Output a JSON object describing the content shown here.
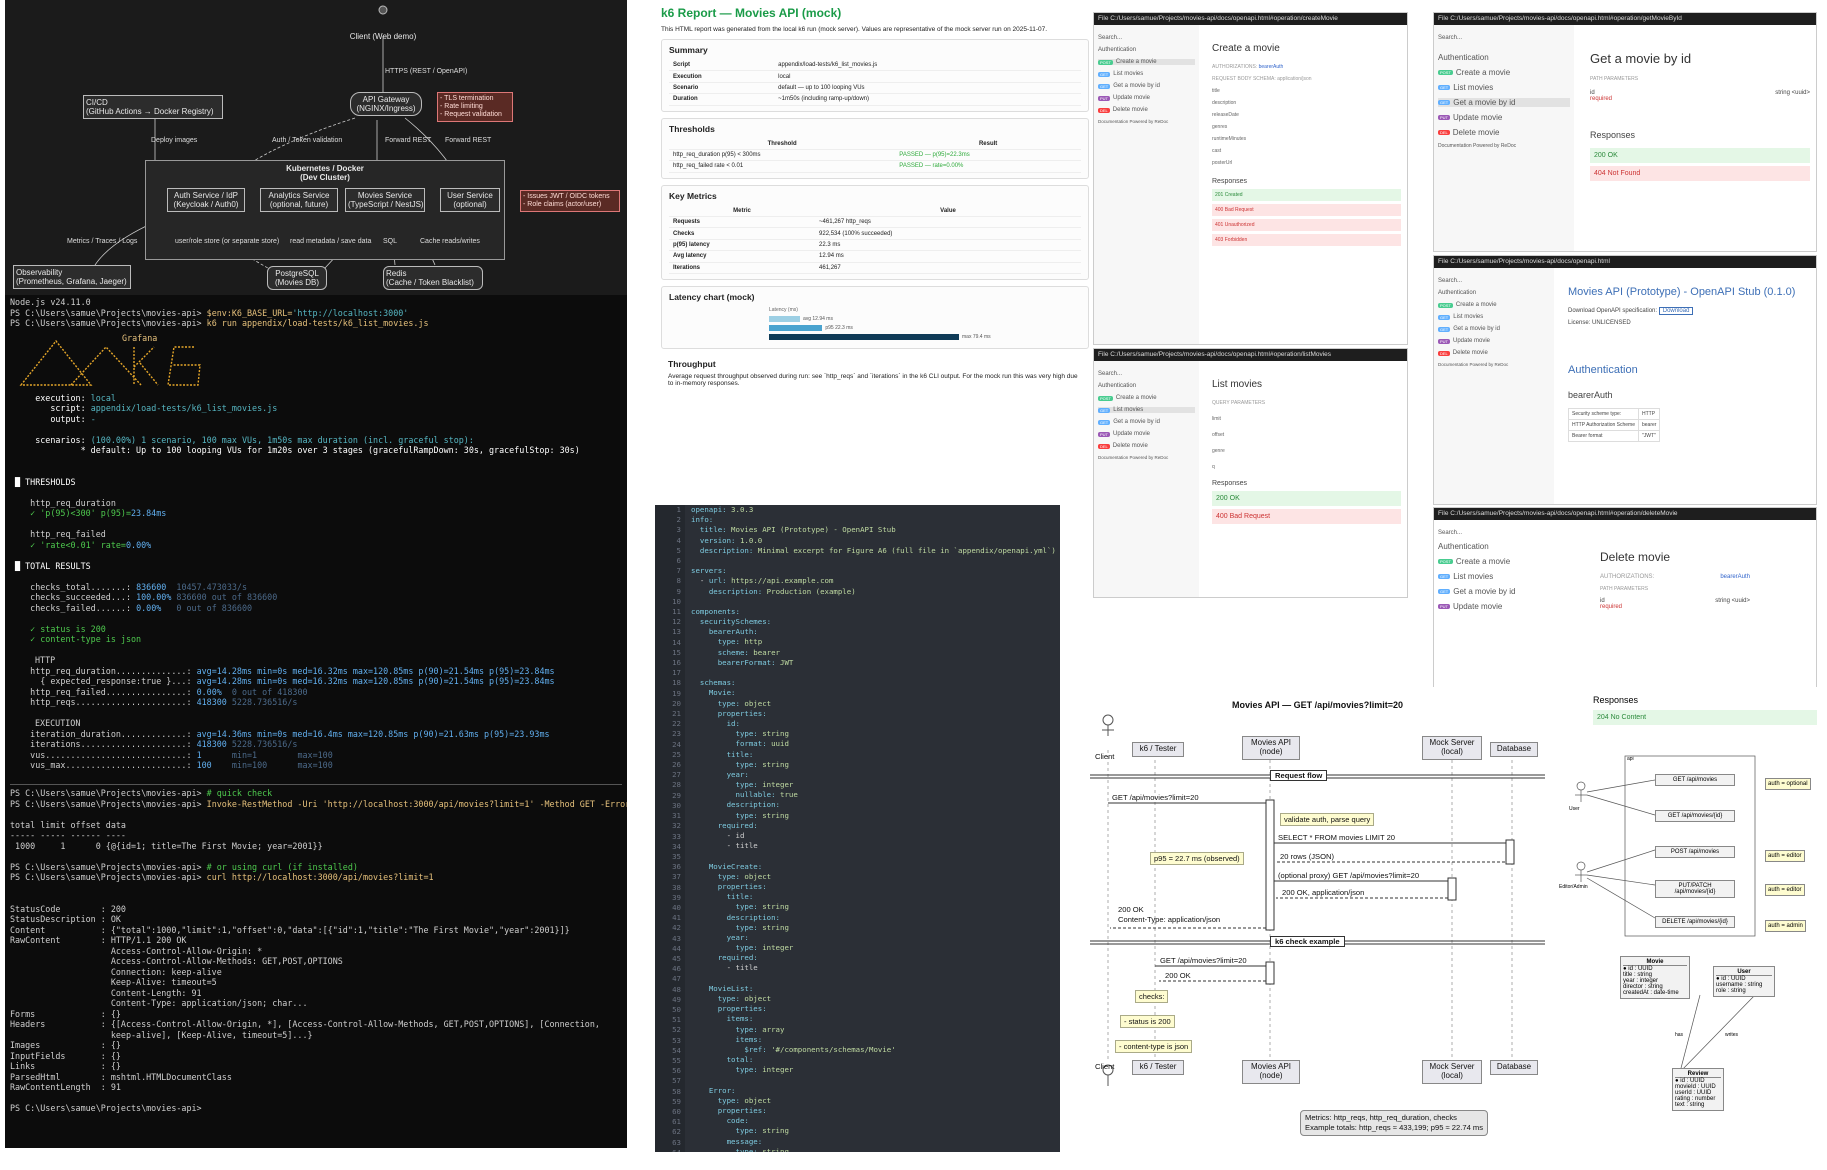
{
  "architecture": {
    "client": "Client\n(Web demo)",
    "https_label": "HTTPS (REST / OpenAPI)",
    "gateway": "API Gateway\n(NGINX/Ingress)",
    "gateway_notes": [
      "- TLS termination",
      "- Rate limiting",
      "- Request validation"
    ],
    "cicd": "CI/CD\n(GitHub Actions → Docker Registry)",
    "deploy_label": "Deploy images",
    "auth_token_label": "Auth / Token validation",
    "forward1": "Forward REST",
    "forward2": "Forward REST",
    "cluster_title": "Kubernetes / Docker\n(Dev Cluster)",
    "auth_service": "Auth Service / IdP\n(Keycloak / Auth0)",
    "analytics": "Analytics Service\n(optional, future)",
    "movies_service": "Movies Service\n(TypeScript / NestJS)",
    "user_service": "User Service\n(optional)",
    "jwt_notes": [
      "- Issues JWT / OIDC tokens",
      "- Role claims (actor/user)"
    ],
    "metrics_label": "Metrics / Traces / Logs",
    "observability": "Observability\n(Prometheus, Grafana, Jaeger)",
    "user_store_label": "user/role store (or separate store)",
    "read_label": "read metadata / save data",
    "sql_label": "SQL",
    "cache_label": "Cache reads/writes",
    "postgres": "PostgreSQL\n(Movies DB)",
    "redis": "Redis\n(Cache / Token Blacklist)"
  },
  "terminal": {
    "lines1": [
      "Node.js v24.11.0"
    ],
    "p1": "PS C:\\Users\\samue\\Projects\\movies-api> ",
    "c1": "$env:K6_BASE_URL=",
    "c1s": "'http://localhost:3000'",
    "p2": "PS C:\\Users\\samue\\Projects\\movies-api> ",
    "c2": "k6 run appendix/load-tests/k6_list_movies.js",
    "grafana": "Grafana",
    "exec_lbl": "execution:",
    "exec_val": "local",
    "script_lbl": "script:",
    "script_val": "appendix/load-tests/k6_list_movies.js",
    "output_lbl": "output:",
    "output_val": "-",
    "scen_lbl": "scenarios:",
    "scen_val": "(100.00%) 1 scenario, 100 max VUs, 1m50s max duration (incl. graceful stop):",
    "scen_def": "* default: Up to 100 looping VUs for 1m20s over 3 stages (gracefulRampDown: 30s, gracefulStop: 30s)",
    "thr_title": "THRESHOLDS",
    "thr1": "http_req_duration",
    "thr1v": "✓ 'p(95)<300' p(95)=",
    "thr1n": "23.84ms",
    "thr2": "http_req_failed",
    "thr2v": "✓ 'rate<0.01' rate=",
    "thr2n": "0.00%",
    "tot_title": "TOTAL RESULTS",
    "ct": "checks_total.......: ",
    "ctv": "836600",
    "ctd": "10457.473033/s",
    "cs": "checks_succeeded...: ",
    "csv": "100.00%",
    "csd": "836600 out of 836600",
    "cf": "checks_failed......: ",
    "cfv": "0.00%",
    "cfd": "0 out of 836600",
    "ok1": "✓ status is 200",
    "ok2": "✓ content-type is json",
    "http": "HTTP",
    "h1": "http_req_duration..............: ",
    "h1v": "avg=14.28ms min=0s med=16.32ms max=120.85ms p(90)=21.54ms p(95)=23.84ms",
    "h2": "  { expected_response:true }...: ",
    "h2v": "avg=14.28ms min=0s med=16.32ms max=120.85ms p(90)=21.54ms p(95)=23.84ms",
    "h3": "http_req_failed................: ",
    "h3v": "0.00%",
    "h3d": "0 out of 418300",
    "h4": "http_reqs......................: ",
    "h4v": "418300",
    "h4d": "5228.736516/s",
    "execu": "EXECUTION",
    "e1": "iteration_duration.............: ",
    "e1v": "avg=14.36ms min=0s med=16.4ms max=120.85ms p(90)=21.63ms p(95)=23.93ms",
    "e2": "iterations.....................: ",
    "e2v": "418300",
    "e2d": "5228.736516/s",
    "e3": "vus............................: ",
    "e3v": "1",
    "e3d": "min=1        max=100",
    "e4": "vus_max........................: ",
    "e4v": "100",
    "e4d": "min=100      max=100",
    "q1": "# quick check",
    "q1c": "Invoke-RestMethod -Uri 'http://localhost:3000/api/movies?limit=1' -Method GET -ErrorAction Stop",
    "tbl_h": "total limit offset data",
    "tbl_s": "----- ----- ------ ----",
    "tbl_r": " 1000     1      0 {@{id=1; title=The First Movie; year=2001}}",
    "q2": "# or using curl (if installed)",
    "q2c": "curl http://localhost:3000/api/movies?limit=1",
    "resp": [
      "StatusCode        : 200",
      "StatusDescription : OK",
      "Content           : {\"total\":1000,\"limit\":1,\"offset\":0,\"data\":[{\"id\":1,\"title\":\"The First Movie\",\"year\":2001}]}",
      "RawContent        : HTTP/1.1 200 OK",
      "                    Access-Control-Allow-Origin: *",
      "                    Access-Control-Allow-Methods: GET,POST,OPTIONS",
      "                    Connection: keep-alive",
      "                    Keep-Alive: timeout=5",
      "                    Content-Length: 91",
      "                    Content-Type: application/json; char...",
      "Forms             : {}",
      "Headers           : {[Access-Control-Allow-Origin, *], [Access-Control-Allow-Methods, GET,POST,OPTIONS], [Connection,",
      "                    keep-alive], [Keep-Alive, timeout=5]...}",
      "Images            : {}",
      "InputFields       : {}",
      "Links             : {}",
      "ParsedHtml        : mshtml.HTMLDocumentClass",
      "RawContentLength  : 91"
    ],
    "prompt_end": "PS C:\\Users\\samue\\Projects\\movies-api>"
  },
  "report": {
    "title": "k6 Report — Movies API (mock)",
    "intro": "This HTML report was generated from the local k6 run (mock server). Values are representative of the mock server run on 2025-11-07.",
    "summary_title": "Summary",
    "summary": [
      [
        "Script",
        "appendix/load-tests/k6_list_movies.js"
      ],
      [
        "Execution",
        "local"
      ],
      [
        "Scenario",
        "default — up to 100 looping VUs"
      ],
      [
        "Duration",
        "~1m50s (including ramp-up/down)"
      ]
    ],
    "thr_title": "Thresholds",
    "thr_cols": [
      "Threshold",
      "Result"
    ],
    "thr": [
      [
        "http_req_duration p(95) < 300ms",
        "PASSED — p(95)=22.3ms"
      ],
      [
        "http_req_failed rate < 0.01",
        "PASSED — rate=0.00%"
      ]
    ],
    "km_title": "Key Metrics",
    "km_cols": [
      "Metric",
      "Value"
    ],
    "km": [
      [
        "Requests",
        "~461,267 http_reqs"
      ],
      [
        "Checks",
        "922,534 (100% succeeded)"
      ],
      [
        "p(95) latency",
        "22.3 ms"
      ],
      [
        "Avg latency",
        "12.94 ms"
      ],
      [
        "Iterations",
        "461,267"
      ]
    ],
    "lat_title": "Latency chart (mock)",
    "lat_axis": "Latency (ms)",
    "lat": [
      {
        "label": "avg 12.94 ms",
        "value": 12.94,
        "color": "#9ccfe4"
      },
      {
        "label": "p95 22.3 ms",
        "value": 22.3,
        "color": "#4aa3cf"
      },
      {
        "label": "max 79.4 ms",
        "value": 79.4,
        "color": "#0f3b57"
      }
    ],
    "tp_title": "Throughput",
    "tp_text": "Average request throughput observed during run: see `http_reqs` and `iterations` in the k6 CLI output. For the mock run this was very high due to in-memory responses."
  },
  "yaml_lines": [
    "openapi: 3.0.3",
    "info:",
    "  title: Movies API (Prototype) - OpenAPI Stub",
    "  version: 1.0.0",
    "  description: Minimal excerpt for Figure A6 (full file in `appendix/openapi.yml`)",
    "",
    "servers:",
    "  - url: https://api.example.com",
    "    description: Production (example)",
    "",
    "components:",
    "  securitySchemes:",
    "    bearerAuth:",
    "      type: http",
    "      scheme: bearer",
    "      bearerFormat: JWT",
    "",
    "  schemas:",
    "    Movie:",
    "      type: object",
    "      properties:",
    "        id:",
    "          type: string",
    "          format: uuid",
    "        title:",
    "          type: string",
    "        year:",
    "          type: integer",
    "          nullable: true",
    "        description:",
    "          type: string",
    "      required:",
    "        - id",
    "        - title",
    "",
    "    MovieCreate:",
    "      type: object",
    "      properties:",
    "        title:",
    "          type: string",
    "        description:",
    "          type: string",
    "        year:",
    "          type: integer",
    "      required:",
    "        - title",
    "",
    "    MovieList:",
    "      type: object",
    "      properties:",
    "        items:",
    "          type: array",
    "          items:",
    "            $ref: '#/components/schemas/Movie'",
    "        total:",
    "          type: integer",
    "",
    "    Error:",
    "      type: object",
    "      properties:",
    "        code:",
    "          type: string",
    "        message:",
    "          type: string"
  ],
  "swagger": {
    "path_create": "C:/Users/samue/Projects/movies-api/docs/openapi.html#operation/createMovie",
    "path_get": "C:/Users/samue/Projects/movies-api/docs/openapi.html#operation/getMovieById",
    "path_list": "C:/Users/samue/Projects/movies-api/docs/openapi.html#operation/listMovies",
    "path_home": "C:/Users/samue/Projects/movies-api/docs/openapi.html",
    "path_delete": "C:/Users/samue/Projects/movies-api/docs/openapi.html#operation/deleteMovie",
    "file": "File",
    "search": "Search...",
    "auth": "Authentication",
    "nav": [
      {
        "m": "POST",
        "l": "Create a movie"
      },
      {
        "m": "GET",
        "l": "List movies"
      },
      {
        "m": "GET",
        "l": "Get a movie by id"
      },
      {
        "m": "PUT",
        "l": "Update movie"
      },
      {
        "m": "DEL",
        "l": "Delete movie"
      }
    ],
    "powered": "Documentation Powered by ReDoc",
    "create_title": "Create a movie",
    "authorizations": "AUTHORIZATIONS:",
    "bearer": "bearerAuth",
    "body_schema": "REQUEST BODY SCHEMA: application/json",
    "create_fields": [
      "title",
      "description",
      "releaseDate",
      "genres",
      "runtimeMinutes",
      "cast",
      "posterUrl"
    ],
    "responses": "Responses",
    "create_resp": [
      "201 Created",
      "400 Bad Request",
      "401 Unauthorized",
      "403 Forbidden"
    ],
    "get_title": "Get a movie by id",
    "path_params": "PATH PARAMETERS",
    "id": "id",
    "required": "required",
    "uuid": "string <uuid>",
    "get_resp": [
      "200 OK",
      "404 Not Found"
    ],
    "list_title": "List movies",
    "query_params": "QUERY PARAMETERS",
    "list_params": [
      "limit",
      "offset",
      "genre",
      "q"
    ],
    "list_resp": [
      "200 OK",
      "400 Bad Request"
    ],
    "home_title": "Movies API (Prototype) - OpenAPI Stub (0.1.0)",
    "download": "Download OpenAPI specification:",
    "download_btn": "Download",
    "license": "License: UNLICENSED",
    "bearer_title": "bearerAuth",
    "sec": [
      [
        "Security scheme type:",
        "HTTP"
      ],
      [
        "HTTP Authorization Scheme",
        "bearer"
      ],
      [
        "Bearer format",
        "\"JWT\""
      ]
    ],
    "delete_title": "Delete movie",
    "del_resp": "204 No Content"
  },
  "sequence": {
    "title": "Movies API — GET /api/movies?limit=20",
    "actors": [
      "Client",
      "k6 / Tester",
      "Movies API\n(node)",
      "Mock Server\n(local)",
      "Database"
    ],
    "group1": "Request flow",
    "group2": "k6 check example",
    "m1": "GET /api/movies?limit=20",
    "n1": "validate auth, parse query",
    "m2": "SELECT * FROM movies LIMIT 20",
    "m3": "20 rows (JSON)",
    "n2": "p95 = 22.7 ms (observed)",
    "m4": "(optional proxy) GET /api/movies?limit=20",
    "m5": "200 OK, application/json",
    "m6": "200 OK\nContent-Type: application/json",
    "m7": "GET /api/movies?limit=20",
    "m8": "200 OK",
    "n3": "checks:",
    "n4": "- status is 200",
    "n5": "- content-type is json",
    "foot": "Metrics: http_reqs, http_req_duration, checks\nExample totals: http_reqs ≈ 433,199; p95 ≈ 22.74 ms"
  },
  "uml": {
    "api": "api",
    "user": "User",
    "editor": "Editor/Admin",
    "routes": [
      {
        "r": "GET /api/movies",
        "n": "auth = optional"
      },
      {
        "r": "GET /api/movies/{id}",
        "n": ""
      },
      {
        "r": "POST /api/movies",
        "n": "auth = editor"
      },
      {
        "r": "PUT/PATCH /api/movies/{id}",
        "n": "auth = editor"
      },
      {
        "r": "DELETE /api/movies/{id}",
        "n": "auth = admin"
      }
    ],
    "movie": [
      "Movie",
      "● id : UUID",
      "title : string",
      "year : integer",
      "director : string",
      "createdAt : date-time"
    ],
    "userent": [
      "User",
      "● id : UUID",
      "username : string",
      "role : string"
    ],
    "review": [
      "Review",
      "● id : UUID",
      "movieId : UUID",
      "userId : UUID",
      "rating : number",
      "text : string"
    ],
    "has": "has",
    "writes": "writes"
  }
}
